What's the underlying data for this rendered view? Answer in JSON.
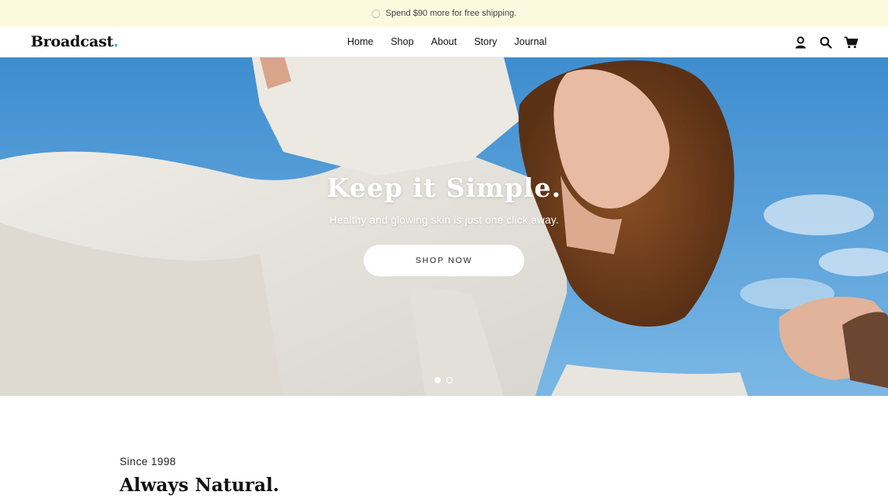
{
  "announcement": {
    "text": "Spend $90 more for free shipping."
  },
  "header": {
    "logo": "Broadcast",
    "logo_dot": ".",
    "nav": [
      "Home",
      "Shop",
      "About",
      "Story",
      "Journal"
    ],
    "icons": [
      "account-icon",
      "search-icon",
      "cart-icon"
    ]
  },
  "hero": {
    "title": "Keep it Simple.",
    "subtitle": "Healthy and glowing skin is just one click away.",
    "cta": "SHOP NOW",
    "slides": 2,
    "active_slide": 1
  },
  "intro": {
    "eyebrow": "Since 1998",
    "heading": "Always Natural."
  },
  "colors": {
    "announcement_bg": "#fbfadf",
    "logo_dot": "#4fa6da",
    "sky": "#5aa3dc"
  }
}
